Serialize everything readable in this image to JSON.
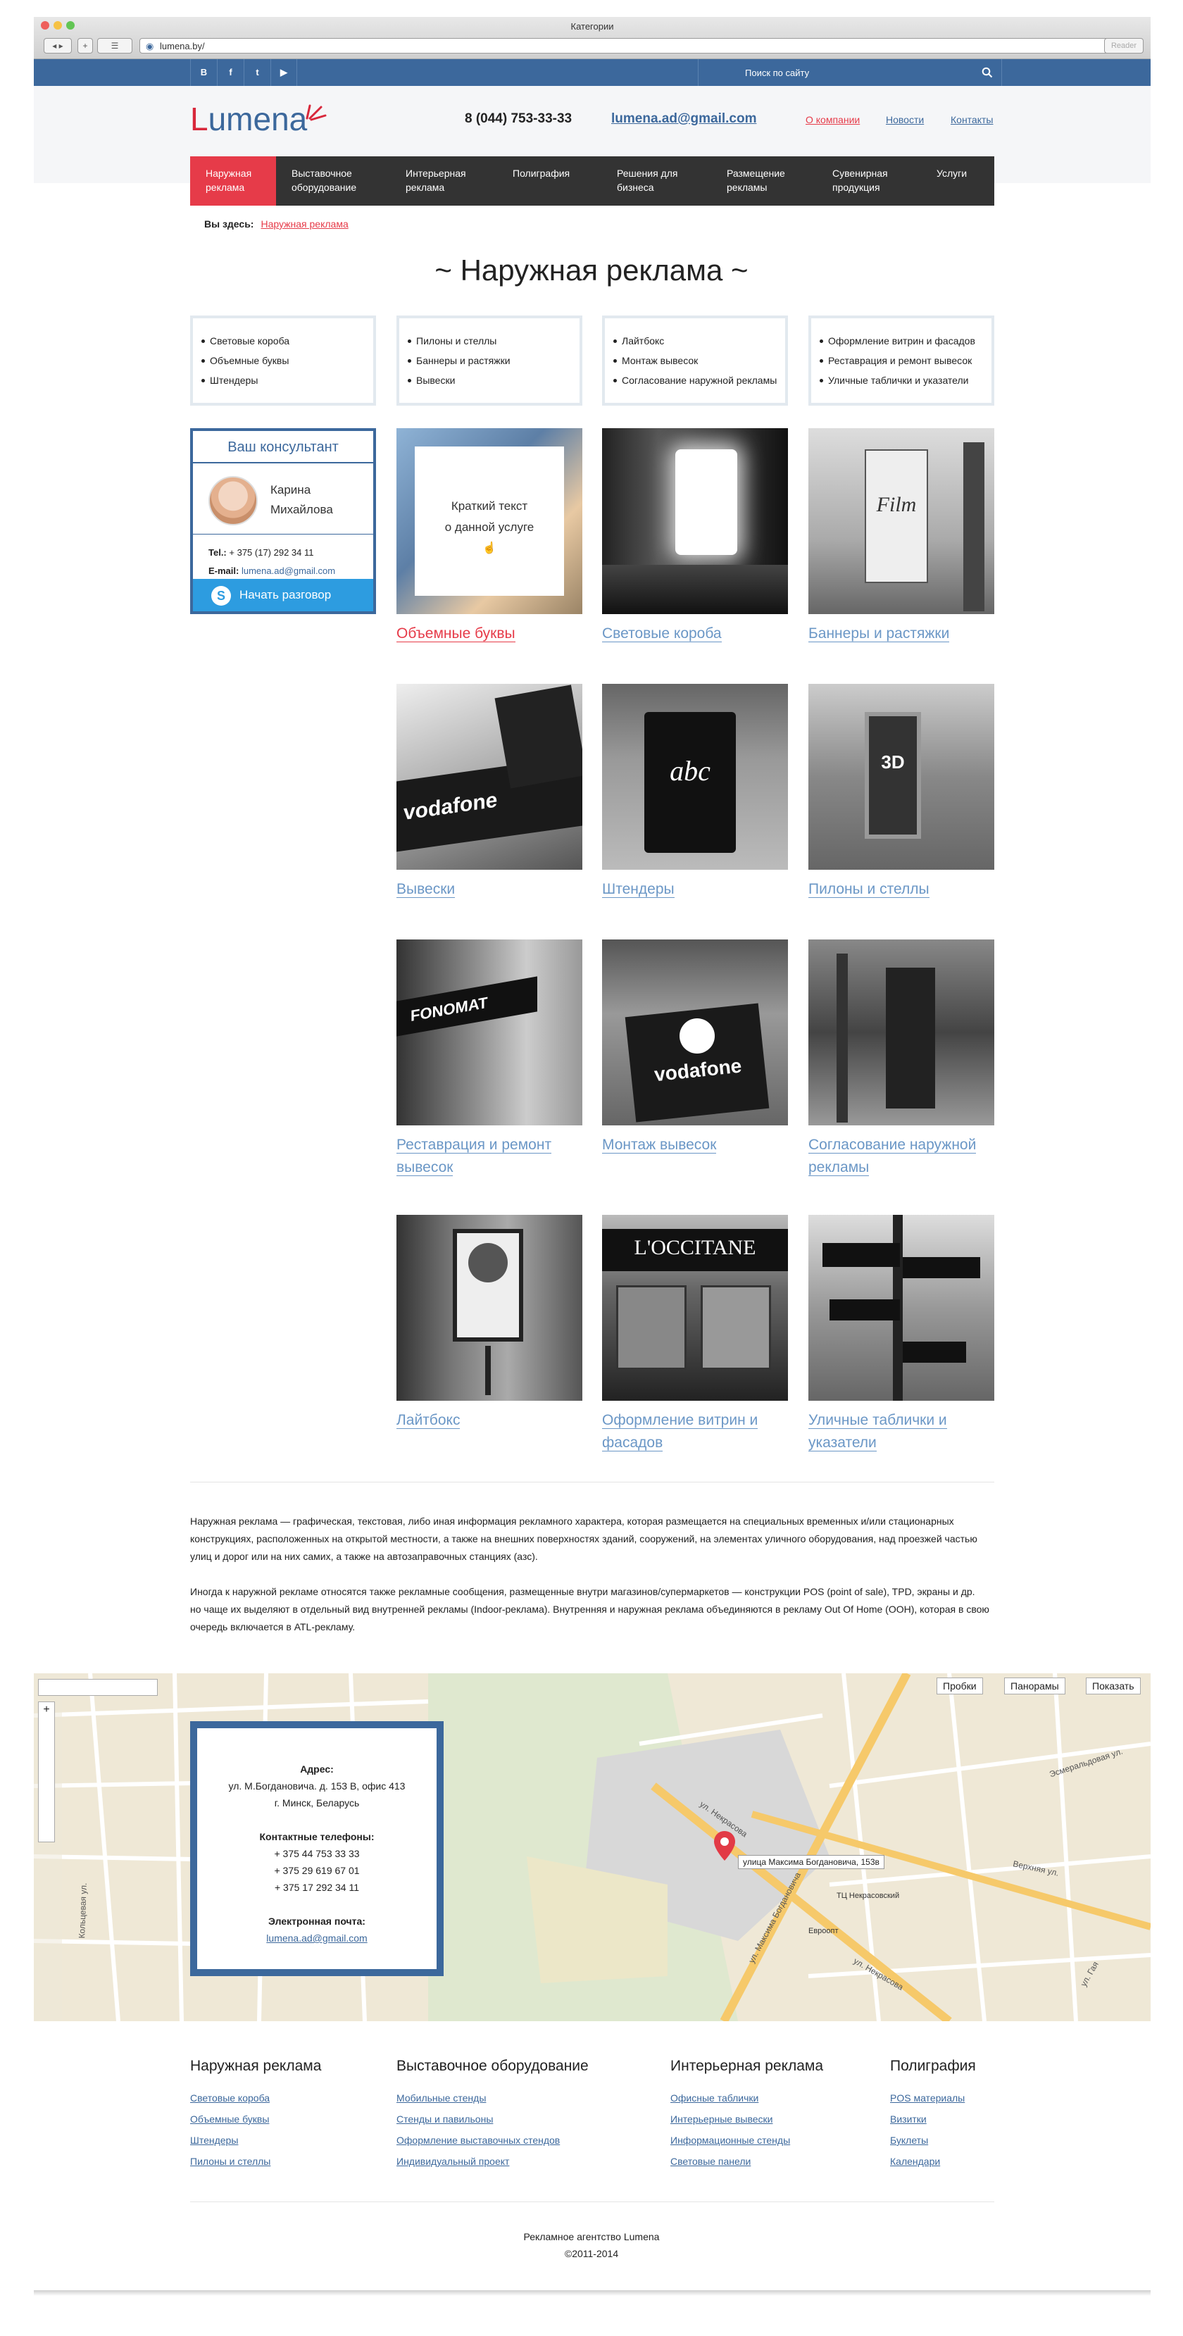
{
  "browser": {
    "title": "Категории",
    "url": "lumena.by/",
    "reader": "Reader"
  },
  "topbar": {
    "social": [
      {
        "name": "vk-icon",
        "label": "В"
      },
      {
        "name": "facebook-icon",
        "label": "f"
      },
      {
        "name": "twitter-icon",
        "label": "t"
      },
      {
        "name": "youtube-icon",
        "label": "▶"
      }
    ],
    "search_placeholder": "Поиск по сайту"
  },
  "header": {
    "logo_first": "L",
    "logo_rest": "umena",
    "phone": "8 (044) 753-33-33",
    "email": "lumena.ad@gmail.com",
    "links": [
      "О компании",
      "Новости",
      "Контакты"
    ]
  },
  "nav": {
    "items": [
      "Наружная реклама",
      "Выставочное оборудование",
      "Интерьерная реклама",
      "Полиграфия",
      "Решения для бизнеса",
      "Размещение рекламы",
      "Сувенирная продукция",
      "Услуги"
    ]
  },
  "breadcrumb": {
    "label": "Вы здесь:",
    "current": "Наружная реклама"
  },
  "page_title": "~ Наружная реклама ~",
  "subcategories": [
    [
      "Световые короба",
      "Объемные буквы",
      "Штендеры"
    ],
    [
      "Пилоны и стеллы",
      "Баннеры и растяжки",
      "Вывески"
    ],
    [
      "Лайтбокс",
      "Монтаж вывесок",
      "Согласование наружной рекламы"
    ],
    [
      "Оформление витрин и фасадов",
      "Реставрация и ремонт вывесок",
      "Уличные таблички и указатели"
    ]
  ],
  "consultant": {
    "heading": "Ваш консультант",
    "name_line1": "Карина",
    "name_line2": "Михайлова",
    "tel_label": "Tel.:",
    "tel": "+ 375 (17) 292 34 11",
    "email_label": "E-mail:",
    "email": "lumena.ad@gmail.com",
    "skype_label": "Начать разговор"
  },
  "tiles": [
    {
      "caption": "Объемные буквы",
      "hover_text_1": "Краткий текст",
      "hover_text_2": "о данной услуге"
    },
    {
      "caption": "Световые короба"
    },
    {
      "caption": "Баннеры и растяжки",
      "photo_text": "Film"
    },
    {
      "caption": "Вывески",
      "photo_text": "vodafone"
    },
    {
      "caption": "Штендеры",
      "photo_text": "abc"
    },
    {
      "caption": "Пилоны и стеллы",
      "photo_text": "3D"
    },
    {
      "caption_1": "Реставрация и ремонт",
      "caption_2": "вывесок",
      "photo_text": "FONOMAT"
    },
    {
      "caption": "Монтаж вывесок",
      "photo_text": "vodafone"
    },
    {
      "caption_1": "Согласование наружной",
      "caption_2": "рекламы"
    },
    {
      "caption": "Лайтбокс"
    },
    {
      "caption_1": "Оформление витрин и",
      "caption_2": "фасадов",
      "photo_text": "L'OCCITANE"
    },
    {
      "caption_1": "Уличные таблички и",
      "caption_2": "указатели"
    }
  ],
  "description": {
    "p1_l1": "Наружная реклама — графическая, текстовая, либо иная информация рекламного характера, которая размещается на специальных временных и/или стационарных",
    "p1_l2": "конструкциях, расположенных на открытой местности, а также на внешних поверхностях зданий, сооружений, на элементах уличного оборудования, над проезжей частью",
    "p1_l3": "улиц и дорог или на них самих, а также на автозаправочных станциях (азс).",
    "p2_l1": "Иногда к наружной рекламе относятся также рекламные сообщения, размещенные внутри магазинов/супермаркетов — конструкции POS (point of sale), TPD, экраны и др.",
    "p2_l2": "но чаще их выделяют в отдельный вид внутренней рекламы (Indoor-реклама). Внутренняя и наружная реклама объединяются в рекламу Out Of Home (OOH), которая в свою",
    "p2_l3": "очередь включается в ATL-рекламу."
  },
  "map": {
    "buttons": [
      "Пробки",
      "Панорамы",
      "Показать"
    ],
    "pin_label": "улица Максима Богдановича, 153в",
    "streets": [
      "ул. Некрасова",
      "ул. Максима Богдановича",
      "Верхняя ул.",
      "ул. Некрасова",
      "Эсмеральдовая ул.",
      "ул. Гая",
      "Кольцевая ул."
    ],
    "places": [
      "ТЦ Некрасовский",
      "Евроопт"
    ],
    "card": {
      "address_label": "Адрес:",
      "address_1": "ул. М.Богдановича. д. 153 В, офис 413",
      "address_2": "г. Минск, Беларусь",
      "phones_label": "Контактные телефоны:",
      "phone_1": "+ 375 44 753 33 33",
      "phone_2": "+ 375 29 619 67 01",
      "phone_3": "+ 375 17 292 34 11",
      "email_label": "Электронная почта:",
      "email": "lumena.ad@gmail.com"
    }
  },
  "footer": {
    "columns": [
      {
        "title": "Наружная реклама",
        "links": [
          "Световые короба",
          "Объемные буквы",
          "Штендеры",
          "Пилоны и стеллы"
        ]
      },
      {
        "title": "Выставочное оборудование",
        "links": [
          "Мобильные стенды",
          "Стенды и павильоны",
          "Оформление выставочных стендов",
          "Индивидуальный проект"
        ]
      },
      {
        "title": "Интерьерная реклама",
        "links": [
          "Офисные таблички",
          "Интерьерные вывески",
          "Информационные стенды",
          "Световые панели"
        ]
      },
      {
        "title": "Полиграфия",
        "links": [
          "POS материалы",
          "Визитки",
          "Буклеты",
          "Календари"
        ]
      }
    ],
    "copyright_1": "Рекламное агентство Lumena",
    "copyright_2": "©2011-2014"
  },
  "colors": {
    "brand_blue": "#3c689c",
    "accent_red": "#e63b49",
    "nav_dark": "#333333",
    "skype_blue": "#2d9ce0"
  }
}
